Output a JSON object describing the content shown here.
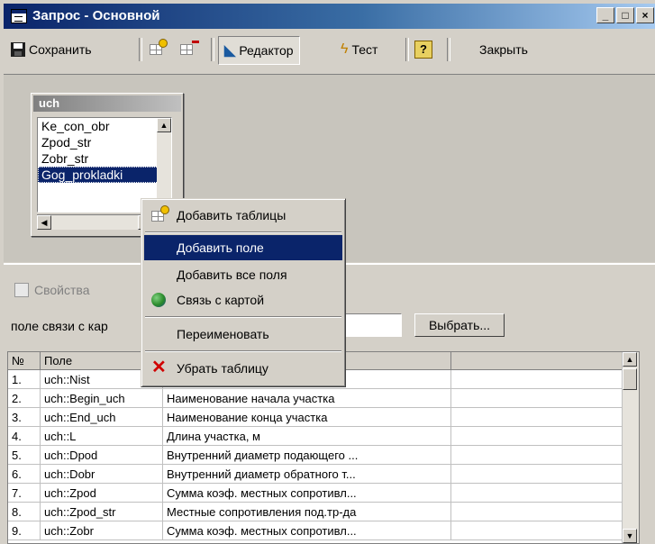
{
  "window": {
    "title": "Запрос - Основной"
  },
  "toolbar": {
    "save_label": "Сохранить",
    "editor_label": "Редактор",
    "test_label": "Тест",
    "close_label": "Закрыть"
  },
  "tablebox": {
    "title": "uch",
    "fields": [
      "Ke_con_obr",
      "Zpod_str",
      "Zobr_str",
      "Gog_prokladki"
    ],
    "selected_field": "Gog_prokladki"
  },
  "context_menu": {
    "items": [
      {
        "label": "Добавить таблицы",
        "icon": "add-table-icon"
      },
      {
        "label": "Добавить поле",
        "highlighted": true
      },
      {
        "label": "Добавить все поля"
      },
      {
        "label": "Связь с картой",
        "icon": "map-link-icon"
      },
      {
        "label": "Переименовать"
      },
      {
        "label": "Убрать таблицу",
        "icon": "remove-icon"
      }
    ]
  },
  "lower": {
    "properties_label": "Свойства",
    "map_link_label": "поле связи с кар",
    "choose_button": "Выбрать..."
  },
  "grid": {
    "headers": [
      "№",
      "Поле"
    ],
    "rows": [
      {
        "n": "1.",
        "field": "uch::Nist",
        "desc": ""
      },
      {
        "n": "2.",
        "field": "uch::Begin_uch",
        "desc": "Наименование начала участка"
      },
      {
        "n": "3.",
        "field": "uch::End_uch",
        "desc": "Наименование конца участка"
      },
      {
        "n": "4.",
        "field": "uch::L",
        "desc": "Длина участка, м"
      },
      {
        "n": "5.",
        "field": "uch::Dpod",
        "desc": "Внутренний диаметр подающего ..."
      },
      {
        "n": "6.",
        "field": "uch::Dobr",
        "desc": "Внутренний диаметр обратного т..."
      },
      {
        "n": "7.",
        "field": "uch::Zpod",
        "desc": "Сумма коэф. местных сопротивл..."
      },
      {
        "n": "8.",
        "field": "uch::Zpod_str",
        "desc": "Местные сопротивления под.тр-да"
      },
      {
        "n": "9.",
        "field": "uch::Zobr",
        "desc": "Сумма коэф. местных сопротивл..."
      }
    ]
  }
}
